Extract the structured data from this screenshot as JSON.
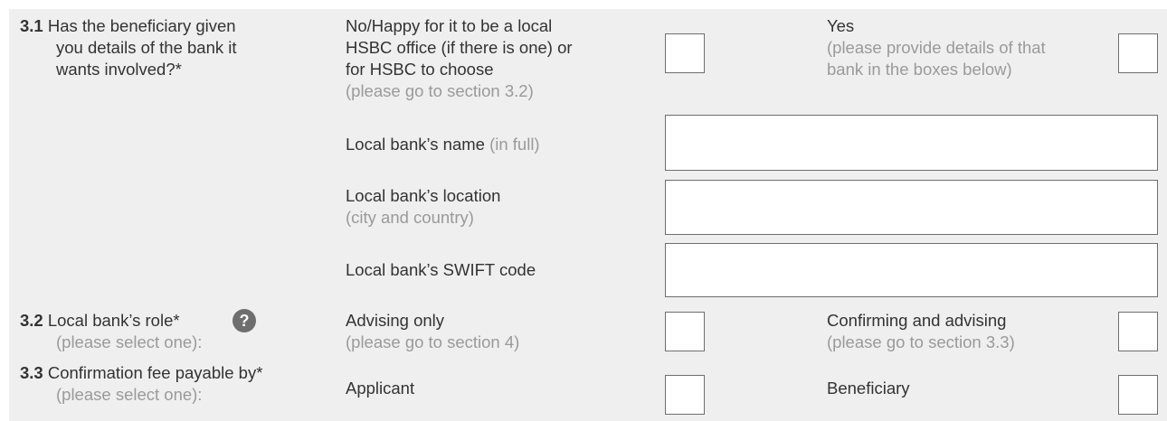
{
  "s31": {
    "number": "3.1",
    "question_lines": [
      "Has the beneficiary given",
      "you details of the bank it",
      "wants involved?*"
    ],
    "no_option_lines": [
      "No/Happy for it to be a local",
      "HSBC office (if there is one) or",
      "for HSBC to choose"
    ],
    "no_option_hint": "(please go to section 3.2)",
    "yes_option": "Yes",
    "yes_hint_lines": [
      "(please provide details of that",
      "bank in the boxes below)"
    ],
    "bank_name_label": "Local bank’s name",
    "bank_name_hint": "(in full)",
    "bank_location_label": "Local bank’s location",
    "bank_location_hint": "(city and country)",
    "bank_swift_label": "Local bank’s SWIFT code"
  },
  "s32": {
    "number": "3.2",
    "question": "Local bank’s role*",
    "hint": "(please select one):",
    "help_glyph": "?",
    "option1": "Advising only",
    "option1_hint": "(please go to section 4)",
    "option2": "Confirming and advising",
    "option2_hint": "(please go to section 3.3)"
  },
  "s33": {
    "number": "3.3",
    "question": "Confirmation fee payable by*",
    "hint": "(please select one):",
    "option1": "Applicant",
    "option2": "Beneficiary"
  }
}
